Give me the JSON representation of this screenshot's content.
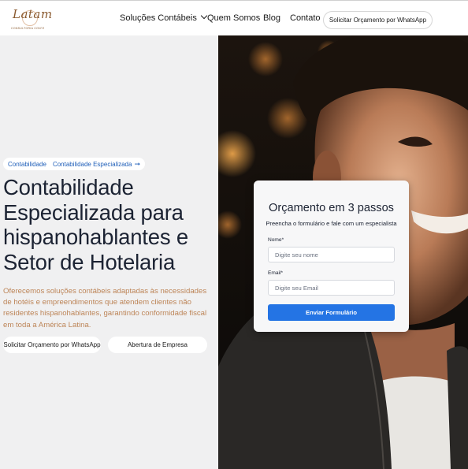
{
  "header": {
    "logo_text": "Latam",
    "logo_tagline": "CONSULTORIA CONTÁBIL",
    "nav": [
      {
        "label": "Soluções Contábeis",
        "has_dropdown": true
      },
      {
        "label": "Quem Somos"
      },
      {
        "label": "Blog"
      },
      {
        "label": "Contato"
      }
    ],
    "cta_label": "Solicitar Orçamento por WhatsApp"
  },
  "hero": {
    "chips": [
      "Contabilidade",
      "Contabilidade Especializada"
    ],
    "chip_arrow_icon": "arrow-right-icon",
    "title_lines": [
      "Contabilidade",
      "Especializada para",
      "hispanohablantes e",
      "Setor de Hotelaria"
    ],
    "description": "Oferecemos soluções contábeis adaptadas às necessidades de hotéis e empreendimentos que atendem clientes não residentes hispanohablantes, garantindo conformidade fiscal em toda a América Latina.",
    "primary_button": "Solicitar Orçamento por WhatsApp",
    "secondary_button": "Abertura de Empresa"
  },
  "form": {
    "title": "Orçamento em 3 passos",
    "subtitle": "Preencha o formulário e fale com um especialista",
    "name_label": "Nome*",
    "name_placeholder": "Digite seu nome",
    "name_value": "",
    "email_label": "Email*",
    "email_placeholder": "Digite seu Email",
    "email_value": "",
    "submit_label": "Enviar Formulário"
  },
  "colors": {
    "accent": "#2474e4",
    "chip_text": "#1f5fb9",
    "description_text": "#bd8558",
    "title_text": "#1c2333",
    "logo": "#8a5a2f"
  }
}
